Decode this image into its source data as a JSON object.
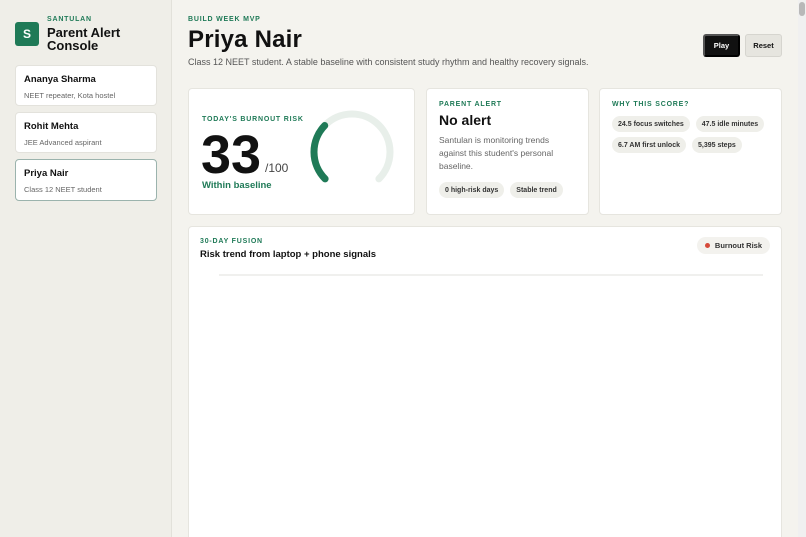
{
  "brand": {
    "logo_letter": "S",
    "eyebrow": "SANTULAN",
    "title": "Parent Alert Console"
  },
  "students": [
    {
      "name": "Ananya Sharma",
      "sub": "NEET repeater, Kota hostel",
      "active": false
    },
    {
      "name": "Rohit Mehta",
      "sub": "JEE Advanced aspirant",
      "active": false
    },
    {
      "name": "Priya Nair",
      "sub": "Class 12 NEET student",
      "active": true
    }
  ],
  "header": {
    "eyebrow": "BUILD WEEK MVP",
    "title": "Priya Nair",
    "subtitle": "Class 12 NEET student. A stable baseline with consistent study rhythm and healthy recovery signals."
  },
  "actions": {
    "play": "Play",
    "reset": "Reset"
  },
  "risk": {
    "eyebrow": "TODAY'S BURNOUT RISK",
    "value": "33",
    "max": "/100",
    "status": "Within baseline",
    "gauge_fraction": 0.33,
    "accent": "#1f7a57",
    "track": "#e8efea"
  },
  "alert": {
    "eyebrow": "PARENT ALERT",
    "title": "No alert",
    "description": "Santulan is monitoring trends against this student's personal baseline.",
    "chips": [
      "0 high-risk days",
      "Stable trend"
    ]
  },
  "why": {
    "eyebrow": "WHY THIS SCORE?",
    "chips": [
      "24.5 focus switches",
      "47.5 idle minutes",
      "6.7 AM first unlock",
      "5,395 steps"
    ]
  },
  "chart": {
    "eyebrow": "30-DAY FUSION",
    "title": "Risk trend from laptop + phone signals",
    "legend": "Burnout Risk",
    "legend_color": "#d64a3a"
  }
}
